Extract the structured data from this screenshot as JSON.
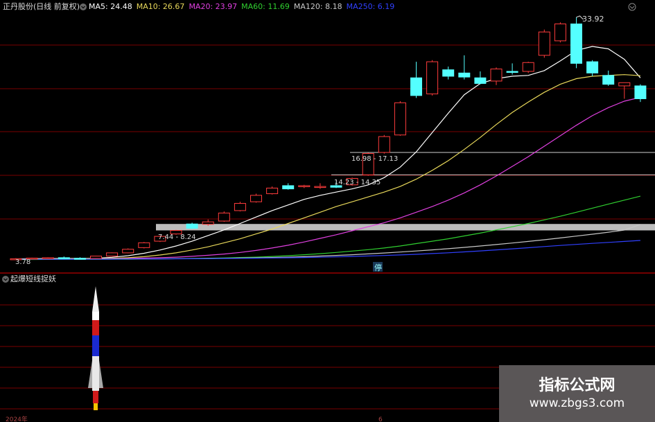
{
  "header": {
    "stock_title": "正丹股份(日线 前复权)",
    "ma_items": [
      {
        "label": "MA5: 24.48",
        "color": "#ffffff"
      },
      {
        "label": "MA10: 26.67",
        "color": "#e8d85a"
      },
      {
        "label": "MA20: 23.97",
        "color": "#e040e0"
      },
      {
        "label": "MA60: 11.69",
        "color": "#30d030"
      },
      {
        "label": "MA120: 8.18",
        "color": "#c8c8c8"
      },
      {
        "label": "MA250: 6.19",
        "color": "#3040ff"
      }
    ]
  },
  "sub_panel": {
    "title": "起爆短线捉妖"
  },
  "axis": {
    "left_label": "2024年",
    "mid_label": "6"
  },
  "annotations": {
    "high": "33.92",
    "low": "3.78",
    "limit_marker": "停",
    "zones": [
      "7.44 - 8.24",
      "14.23 - 14.35",
      "16.98 - 17.13"
    ]
  },
  "watermark": {
    "line1": "指标公式网",
    "line2": "www.zbgs3.com"
  },
  "colors": {
    "up": "#ff3c3c",
    "down": "#54ffff",
    "grid": "#7a0000"
  },
  "chart_data": {
    "type": "candlestick",
    "ylim": [
      3.0,
      36.0
    ],
    "candles": [
      {
        "o": 3.9,
        "h": 4.0,
        "l": 3.78,
        "c": 3.92
      },
      {
        "o": 3.95,
        "h": 4.05,
        "l": 3.85,
        "c": 4.0
      },
      {
        "o": 4.0,
        "h": 4.1,
        "l": 3.9,
        "c": 4.05
      },
      {
        "o": 4.05,
        "h": 4.2,
        "l": 3.95,
        "c": 3.98
      },
      {
        "o": 3.98,
        "h": 4.1,
        "l": 3.9,
        "c": 3.95
      },
      {
        "o": 3.95,
        "h": 4.3,
        "l": 3.9,
        "c": 4.25
      },
      {
        "o": 4.25,
        "h": 4.7,
        "l": 4.2,
        "c": 4.65
      },
      {
        "o": 4.65,
        "h": 5.2,
        "l": 4.6,
        "c": 5.1
      },
      {
        "o": 5.3,
        "h": 6.0,
        "l": 5.2,
        "c": 5.9
      },
      {
        "o": 6.1,
        "h": 6.8,
        "l": 6.0,
        "c": 6.7
      },
      {
        "o": 7.0,
        "h": 7.5,
        "l": 6.9,
        "c": 7.44
      },
      {
        "o": 8.24,
        "h": 8.4,
        "l": 7.6,
        "c": 7.7
      },
      {
        "o": 8.2,
        "h": 8.8,
        "l": 8.0,
        "c": 8.5
      },
      {
        "o": 8.6,
        "h": 9.8,
        "l": 8.5,
        "c": 9.6
      },
      {
        "o": 9.9,
        "h": 11.0,
        "l": 9.8,
        "c": 10.8
      },
      {
        "o": 11.0,
        "h": 12.0,
        "l": 10.9,
        "c": 11.8
      },
      {
        "o": 12.0,
        "h": 12.9,
        "l": 11.9,
        "c": 12.7
      },
      {
        "o": 13.0,
        "h": 13.3,
        "l": 12.5,
        "c": 12.6
      },
      {
        "o": 12.9,
        "h": 13.1,
        "l": 12.7,
        "c": 13.0
      },
      {
        "o": 12.9,
        "h": 13.3,
        "l": 12.6,
        "c": 12.9
      },
      {
        "o": 13.0,
        "h": 13.5,
        "l": 12.7,
        "c": 12.8
      },
      {
        "o": 13.1,
        "h": 14.0,
        "l": 13.0,
        "c": 13.9
      },
      {
        "o": 14.35,
        "h": 17.1,
        "l": 14.23,
        "c": 17.0
      },
      {
        "o": 17.13,
        "h": 19.3,
        "l": 16.98,
        "c": 19.1
      },
      {
        "o": 19.3,
        "h": 23.5,
        "l": 19.2,
        "c": 23.3
      },
      {
        "o": 26.4,
        "h": 28.4,
        "l": 23.9,
        "c": 24.2
      },
      {
        "o": 24.4,
        "h": 28.6,
        "l": 24.2,
        "c": 28.4
      },
      {
        "o": 27.4,
        "h": 27.8,
        "l": 26.2,
        "c": 26.6
      },
      {
        "o": 27.0,
        "h": 29.2,
        "l": 26.2,
        "c": 26.5
      },
      {
        "o": 26.4,
        "h": 27.2,
        "l": 25.6,
        "c": 25.7
      },
      {
        "o": 26.0,
        "h": 27.7,
        "l": 25.5,
        "c": 27.5
      },
      {
        "o": 27.2,
        "h": 28.2,
        "l": 26.8,
        "c": 27.1
      },
      {
        "o": 27.2,
        "h": 28.4,
        "l": 27.0,
        "c": 28.3
      },
      {
        "o": 29.2,
        "h": 32.4,
        "l": 28.9,
        "c": 32.1
      },
      {
        "o": 31.0,
        "h": 33.3,
        "l": 30.8,
        "c": 33.1
      },
      {
        "o": 33.1,
        "h": 33.92,
        "l": 27.6,
        "c": 28.2
      },
      {
        "o": 28.4,
        "h": 28.6,
        "l": 26.6,
        "c": 27.0
      },
      {
        "o": 26.7,
        "h": 27.3,
        "l": 25.4,
        "c": 25.6
      },
      {
        "o": 25.4,
        "h": 25.8,
        "l": 23.8,
        "c": 25.8
      },
      {
        "o": 25.4,
        "h": 25.6,
        "l": 23.4,
        "c": 23.8
      }
    ],
    "ma": [
      {
        "name": "MA5",
        "values": [
          3.9,
          3.92,
          3.94,
          3.95,
          3.96,
          3.98,
          4.1,
          4.3,
          4.6,
          5.0,
          5.5,
          6.1,
          6.8,
          7.5,
          8.3,
          9.1,
          9.9,
          10.6,
          11.3,
          11.8,
          12.2,
          12.6,
          13.1,
          14.0,
          15.3,
          17.2,
          19.6,
          22.0,
          24.3,
          25.7,
          26.3,
          26.6,
          26.7,
          27.3,
          28.5,
          29.8,
          30.3,
          30.0,
          28.7,
          26.4
        ]
      },
      {
        "name": "MA10",
        "values": [
          3.9,
          3.91,
          3.92,
          3.93,
          3.94,
          3.95,
          3.98,
          4.05,
          4.18,
          4.38,
          4.65,
          5.0,
          5.4,
          5.9,
          6.4,
          7.0,
          7.6,
          8.3,
          9.0,
          9.7,
          10.4,
          11.0,
          11.6,
          12.2,
          12.9,
          13.8,
          14.9,
          16.1,
          17.5,
          19.0,
          20.6,
          22.1,
          23.4,
          24.6,
          25.6,
          26.3,
          26.6,
          26.7,
          26.8,
          26.67
        ]
      },
      {
        "name": "MA20",
        "values": [
          3.9,
          3.9,
          3.9,
          3.9,
          3.9,
          3.91,
          3.92,
          3.95,
          4.0,
          4.05,
          4.12,
          4.22,
          4.35,
          4.5,
          4.7,
          4.95,
          5.25,
          5.6,
          6.0,
          6.45,
          6.9,
          7.4,
          7.9,
          8.4,
          9.0,
          9.7,
          10.4,
          11.2,
          12.1,
          13.1,
          14.2,
          15.4,
          16.6,
          17.9,
          19.2,
          20.5,
          21.7,
          22.7,
          23.5,
          23.97
        ]
      },
      {
        "name": "MA60",
        "values": [
          3.82,
          3.82,
          3.83,
          3.83,
          3.84,
          3.84,
          3.85,
          3.86,
          3.88,
          3.9,
          3.92,
          3.95,
          3.98,
          4.02,
          4.07,
          4.12,
          4.2,
          4.3,
          4.42,
          4.55,
          4.7,
          4.87,
          5.05,
          5.25,
          5.5,
          5.8,
          6.1,
          6.4,
          6.75,
          7.1,
          7.5,
          7.9,
          8.3,
          8.75,
          9.2,
          9.7,
          10.2,
          10.7,
          11.2,
          11.69
        ]
      },
      {
        "name": "MA120",
        "values": [
          3.9,
          3.9,
          3.9,
          3.89,
          3.89,
          3.89,
          3.89,
          3.9,
          3.9,
          3.91,
          3.92,
          3.93,
          3.95,
          3.97,
          4.0,
          4.03,
          4.07,
          4.12,
          4.18,
          4.25,
          4.33,
          4.42,
          4.52,
          4.63,
          4.75,
          4.88,
          5.02,
          5.17,
          5.33,
          5.5,
          5.68,
          5.87,
          6.07,
          6.28,
          6.5,
          6.73,
          6.97,
          7.22,
          7.48,
          8.18
        ]
      },
      {
        "name": "MA250",
        "values": [
          3.84,
          3.85,
          3.85,
          3.86,
          3.86,
          3.87,
          3.87,
          3.88,
          3.89,
          3.9,
          3.91,
          3.92,
          3.93,
          3.95,
          3.97,
          3.99,
          4.01,
          4.04,
          4.07,
          4.11,
          4.15,
          4.2,
          4.26,
          4.32,
          4.39,
          4.47,
          4.56,
          4.66,
          4.77,
          4.89,
          5.02,
          5.15,
          5.29,
          5.43,
          5.57,
          5.7,
          5.83,
          5.95,
          6.07,
          6.19
        ]
      }
    ],
    "signal": {
      "index": 5,
      "label": "rocket"
    }
  }
}
